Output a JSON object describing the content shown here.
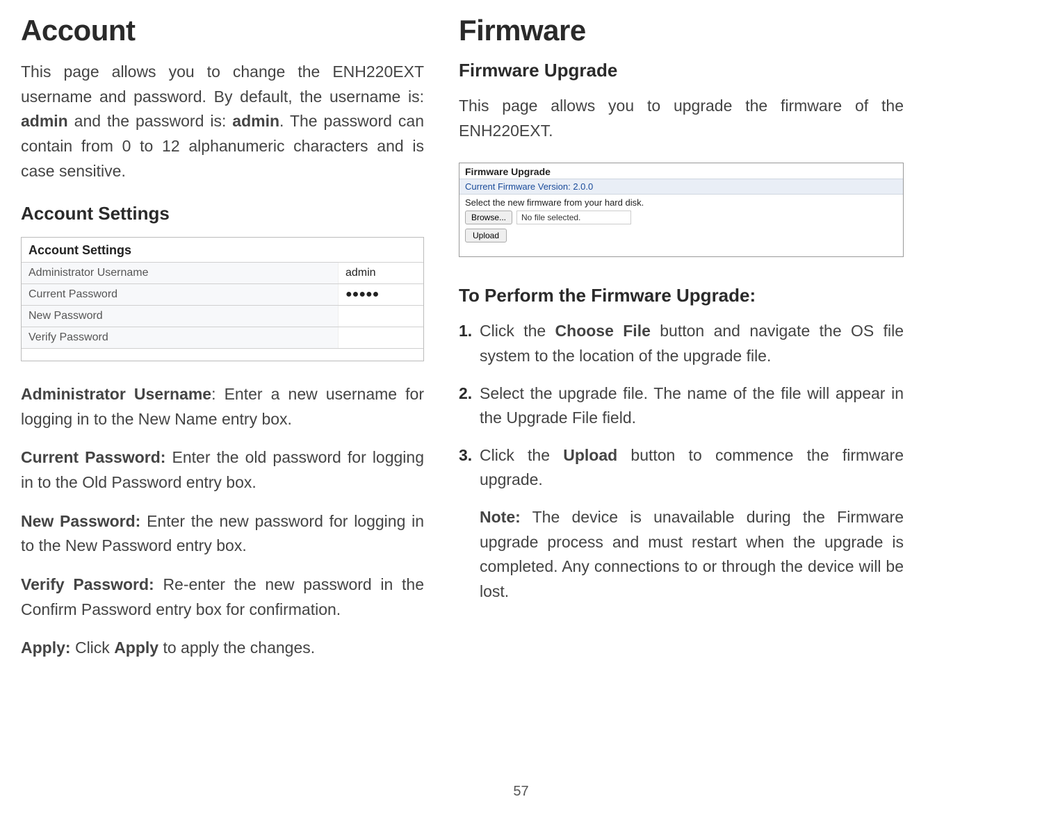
{
  "page_number": "57",
  "left": {
    "heading": "Account",
    "intro_parts": {
      "p1": "This page allows you to change the ENH220EXT username and password. By default, the username is: ",
      "b1": "admin",
      "p2": " and the password is: ",
      "b2": "admin",
      "p3": ". The password can contain from 0 to 12 alphanumeric characters and is case sensitive."
    },
    "section_title": "Account Settings",
    "table": {
      "title": "Account Settings",
      "rows": [
        {
          "label": "Administrator Username",
          "value": "admin"
        },
        {
          "label": "Current Password",
          "value": "●●●●●"
        },
        {
          "label": "New Password",
          "value": ""
        },
        {
          "label": "Verify Password",
          "value": ""
        }
      ]
    },
    "defs": [
      {
        "term": "Administrator Username",
        "sep": ": ",
        "text": "Enter a new username for logging in to the New Name entry box."
      },
      {
        "term": "Current Password:",
        "sep": " ",
        "text": "Enter the old password for logging in to the Old Password entry box."
      },
      {
        "term": "New Password:",
        "sep": " ",
        "text": "Enter the new password for logging in to the New Password entry box."
      },
      {
        "term": "Verify Password:",
        "sep": " ",
        "text": "Re-enter the new password in the Confirm Password entry box for confirmation."
      },
      {
        "term": "Apply:",
        "sep": " ",
        "text_pre": "Click ",
        "bold_mid": "Apply",
        "text_post": " to apply the changes."
      }
    ]
  },
  "right": {
    "heading": "Firmware",
    "section_title": "Firmware Upgrade",
    "intro": "This page allows you to upgrade the firmware of the ENH220EXT.",
    "box": {
      "title": "Firmware Upgrade",
      "version": "Current Firmware Version: 2.0.0",
      "select_text": "Select the new firmware from your hard disk.",
      "browse_label": "Browse...",
      "file_status": "No file selected.",
      "upload_label": "Upload"
    },
    "steps_title": "To Perform the Firmware Upgrade:",
    "steps": [
      {
        "num": "1.",
        "pre": "Click the ",
        "bold": "Choose File",
        "post": " button and navigate the OS file system to the location of the upgrade file."
      },
      {
        "num": "2.",
        "pre": "Select the upgrade file. The name of the file will appear in the Upgrade File field.",
        "bold": "",
        "post": ""
      },
      {
        "num": "3.",
        "pre": "Click the ",
        "bold": "Upload",
        "post": " button to commence the firmware upgrade."
      }
    ],
    "note": {
      "label": "Note:",
      "text": " The device is unavailable during the Firmware upgrade process and must restart when the upgrade is completed. Any connections to or through the device will be lost."
    }
  }
}
